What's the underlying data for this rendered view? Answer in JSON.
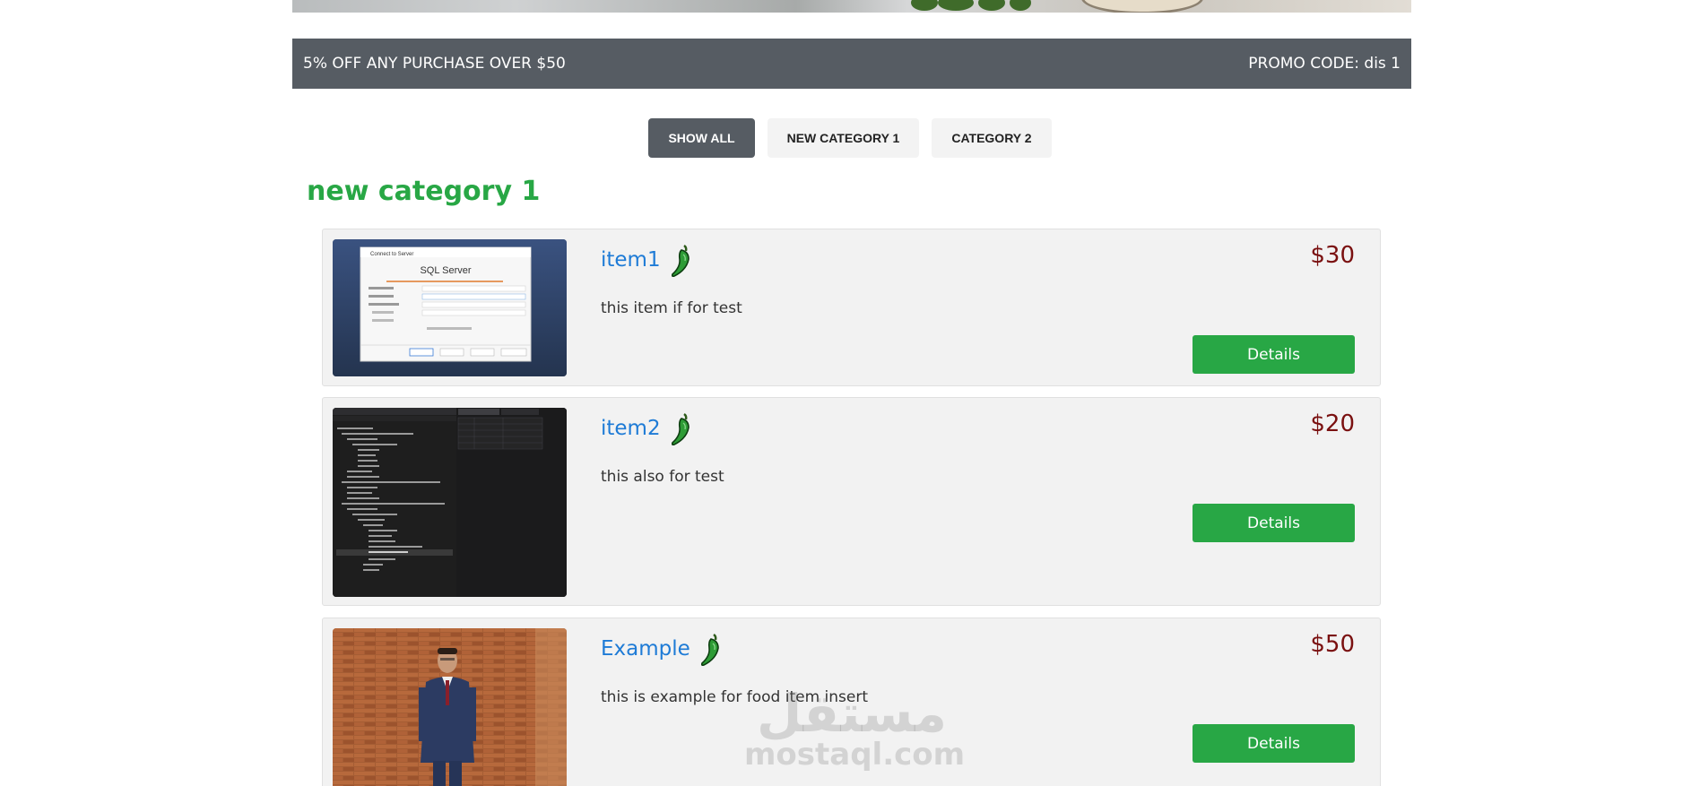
{
  "promo": {
    "left_text": "5% OFF ANY PURCHASE OVER $50",
    "right_text": "PROMO CODE: dis 1"
  },
  "filters": [
    {
      "label": "SHOW ALL",
      "active": true
    },
    {
      "label": "NEW CATEGORY 1",
      "active": false
    },
    {
      "label": "CATEGORY 2",
      "active": false
    }
  ],
  "category": {
    "title": "new category 1"
  },
  "items": [
    {
      "name": "item1",
      "price": "$30",
      "description": "this item if for test",
      "details_label": "Details",
      "icon": "chili-pepper-icon",
      "thumbnail": {
        "dialog_title": "Connect to Server",
        "dialog_heading": "SQL Server"
      }
    },
    {
      "name": "item2",
      "price": "$20",
      "description": "this also for test",
      "details_label": "Details",
      "icon": "chili-pepper-icon"
    },
    {
      "name": "Example",
      "price": "$50",
      "description": "this is example for food item insert",
      "details_label": "Details",
      "icon": "chili-pepper-icon"
    }
  ],
  "watermark": {
    "mark": "مستقل",
    "text": "mostaql.com"
  },
  "colors": {
    "promo_bg": "#565c63",
    "accent_green": "#28a745",
    "link_blue": "#1e7bd6",
    "price_red": "#7a1010"
  }
}
